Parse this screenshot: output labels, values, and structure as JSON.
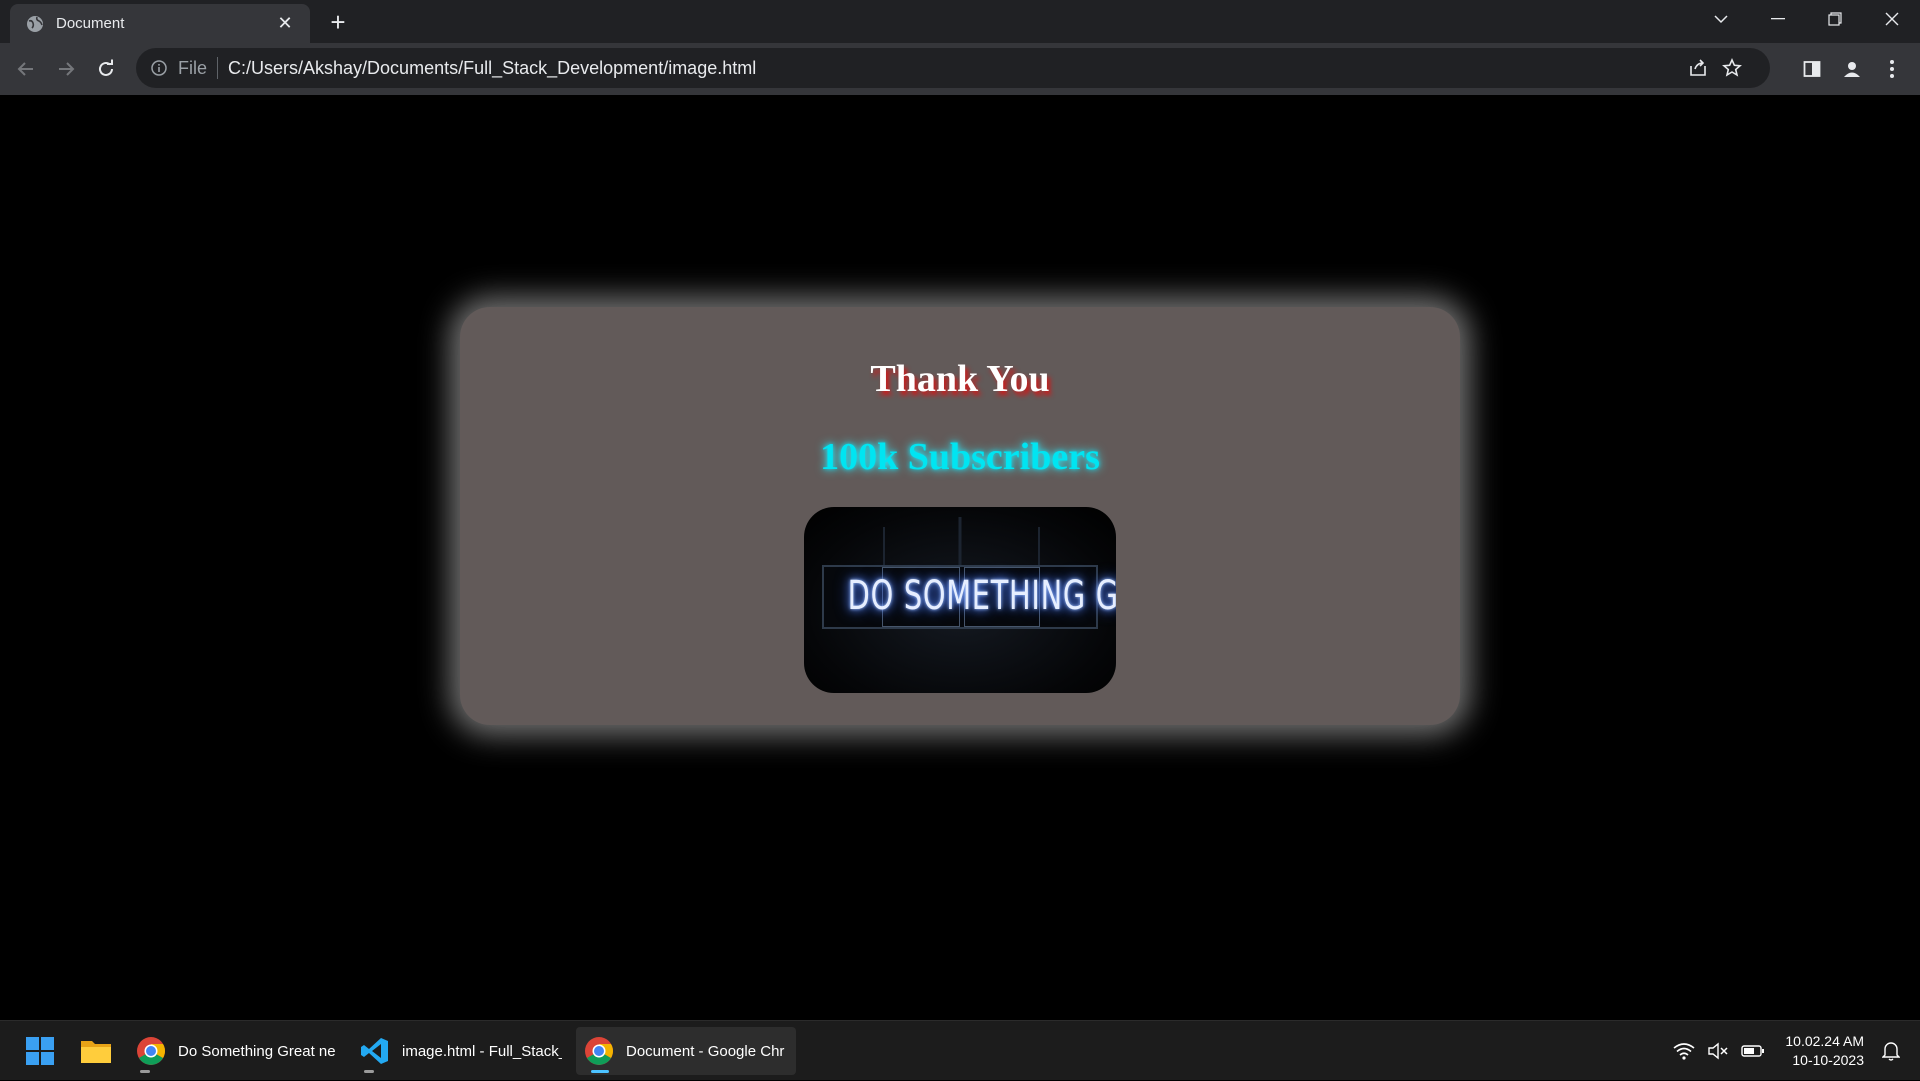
{
  "browser": {
    "tab_title": "Document",
    "close_tab_glyph": "✕",
    "new_tab_glyph": "+",
    "scheme_label": "File",
    "url": "C:/Users/Akshay/Documents/Full_Stack_Development/image.html"
  },
  "page": {
    "heading": "Thank You",
    "subheading": "100k Subscribers",
    "image_text": "DO SOMETHING GREAT",
    "colors": {
      "card_background": "#625a59",
      "heading_color": "#ffffff",
      "heading_shadow": "#d01818",
      "subheading_color": "#00e5f2"
    }
  },
  "taskbar": {
    "items": [
      {
        "label": "Do Something Great ne",
        "icon": "chrome-icon"
      },
      {
        "label": "image.html - Full_Stack_",
        "icon": "vscode-icon"
      },
      {
        "label": "Document - Google Chr",
        "icon": "chrome-icon",
        "active": true
      }
    ],
    "time": "10.02.24 AM",
    "date": "10-10-2023"
  }
}
